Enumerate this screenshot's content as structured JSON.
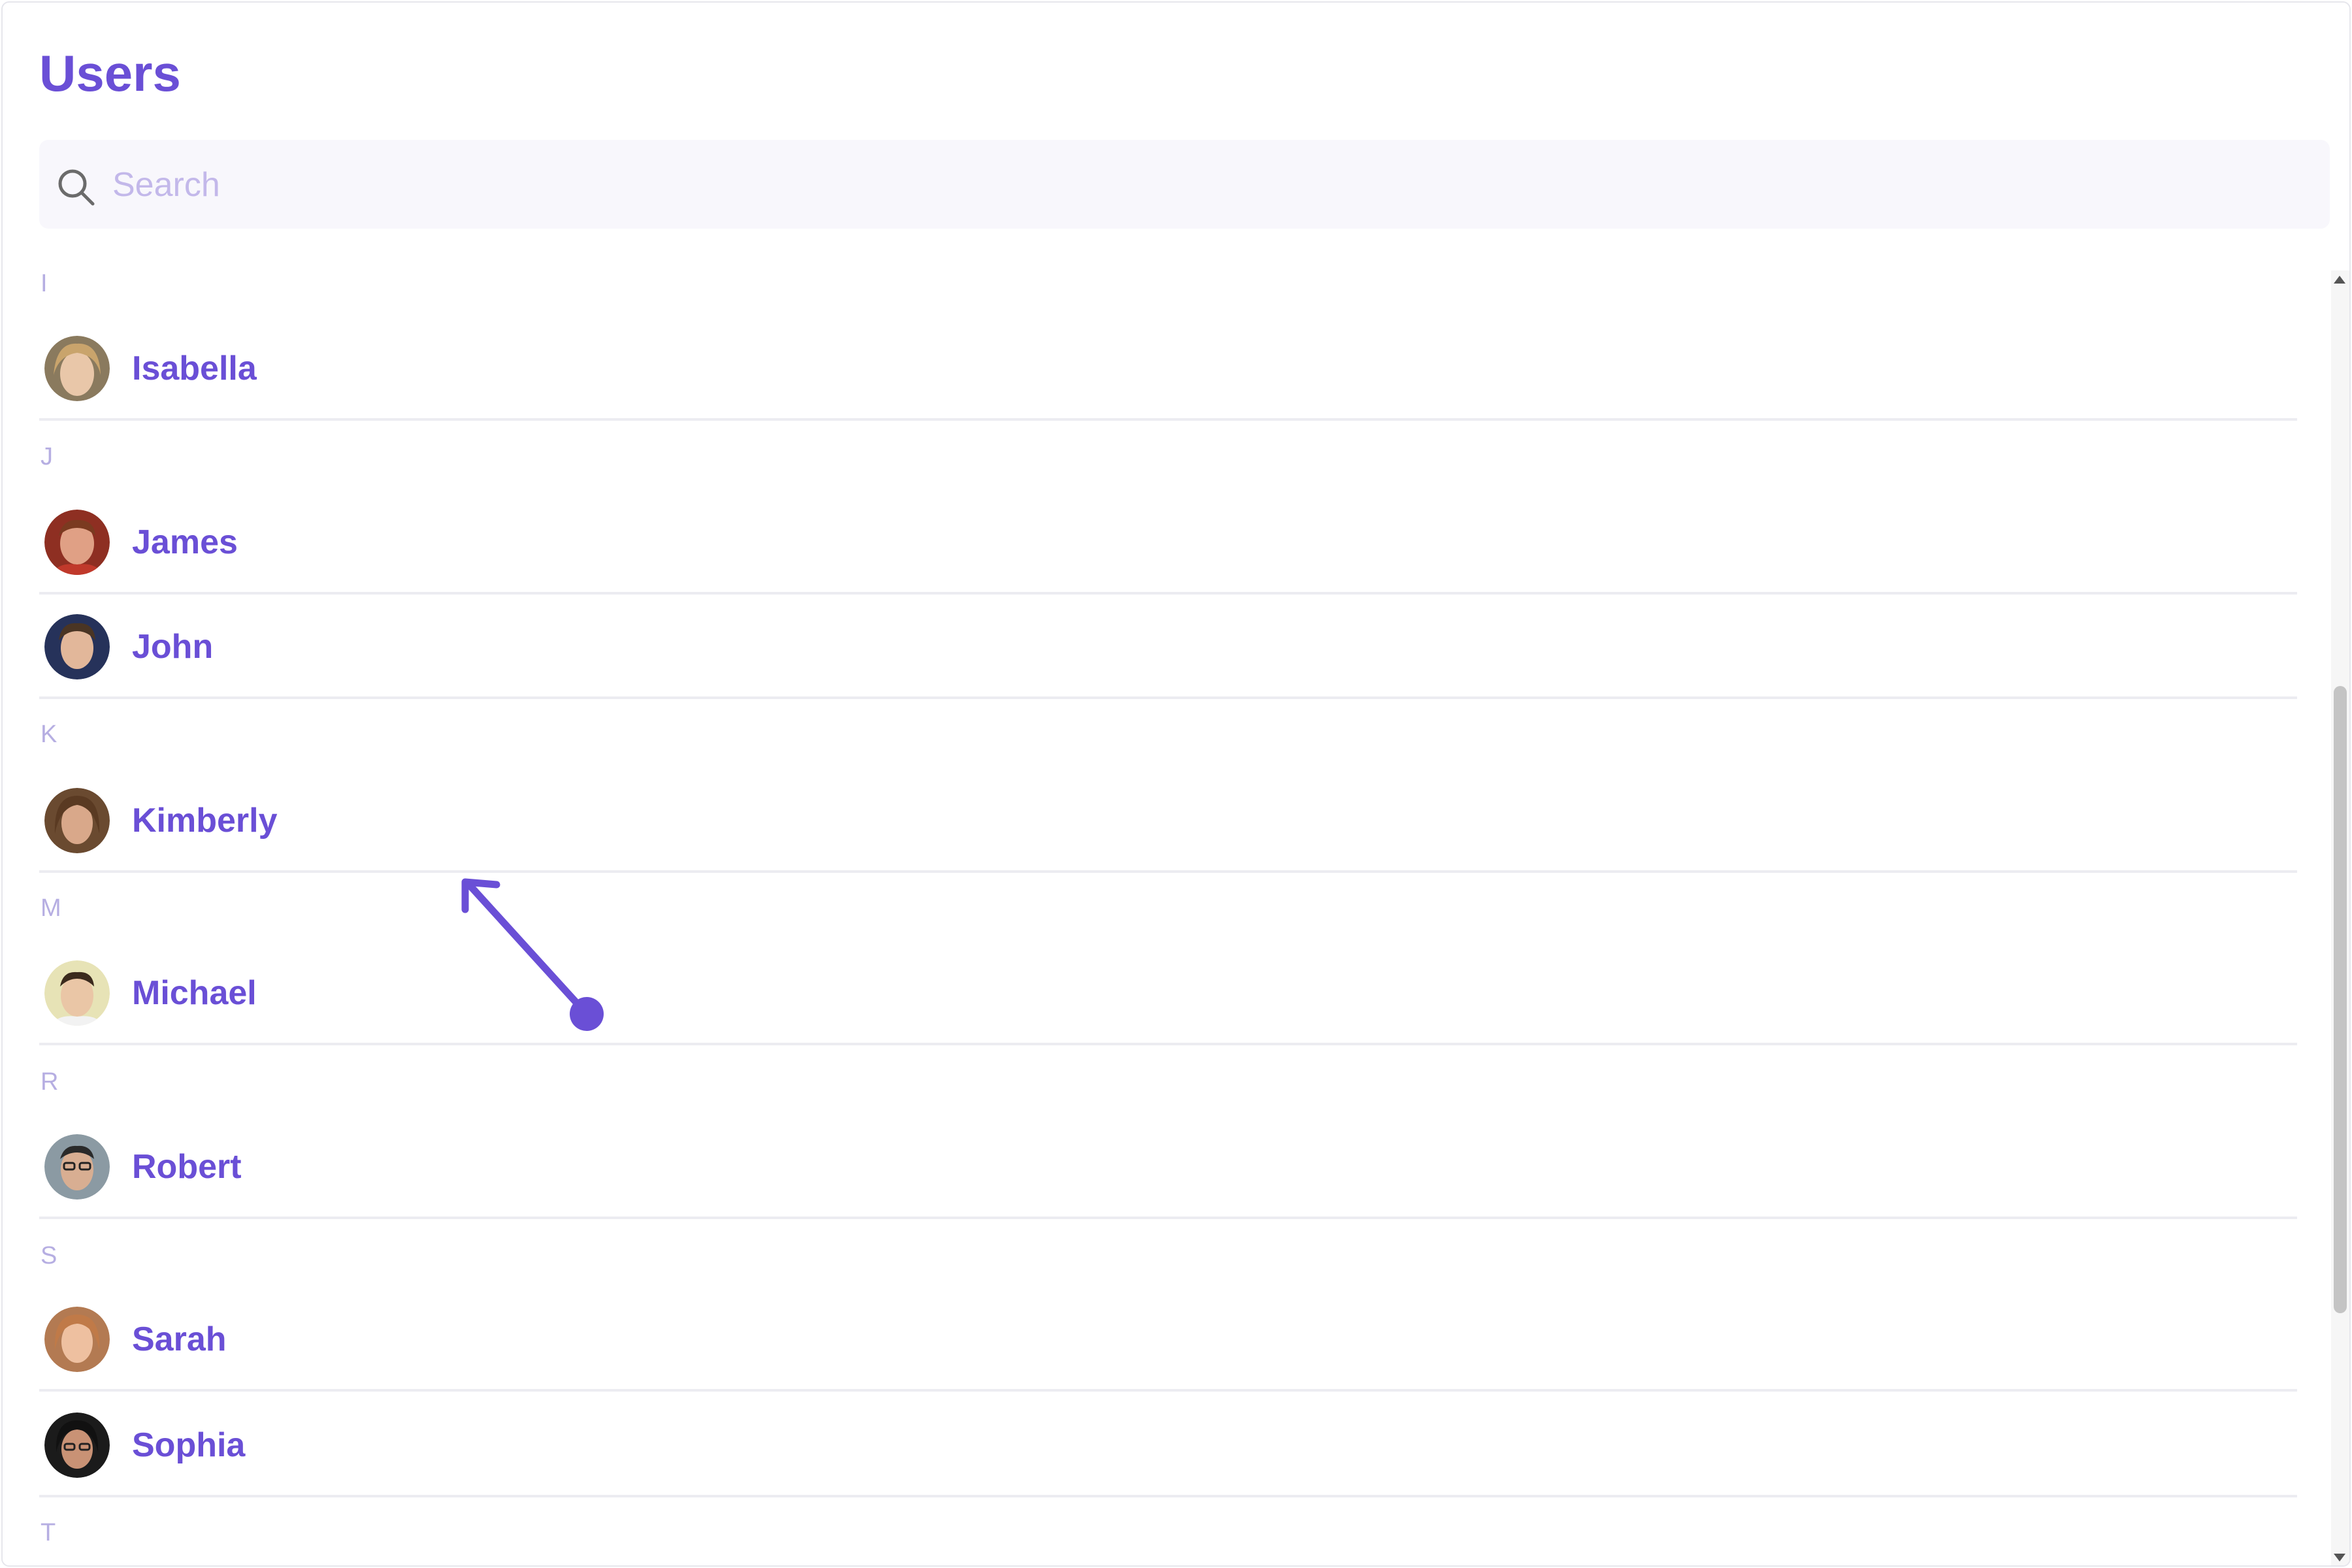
{
  "page": {
    "title": "Users"
  },
  "search": {
    "placeholder": "Search",
    "value": ""
  },
  "colors": {
    "accent": "#6a4fd6",
    "section_letter": "#b6aee2",
    "divider": "#ececf1",
    "search_bg": "#f8f7fc"
  },
  "icons": {
    "search": "search-icon",
    "drag_arrow": "arrow-up-left-icon",
    "drag_point": "touch-point-icon"
  },
  "list": {
    "sections": [
      {
        "letter": "I",
        "users": [
          {
            "name": "Isabella",
            "avatar": "avatar-isabella"
          }
        ]
      },
      {
        "letter": "J",
        "users": [
          {
            "name": "James",
            "avatar": "avatar-james"
          },
          {
            "name": "John",
            "avatar": "avatar-john"
          }
        ]
      },
      {
        "letter": "K",
        "users": [
          {
            "name": "Kimberly",
            "avatar": "avatar-kimberly"
          }
        ]
      },
      {
        "letter": "M",
        "users": [
          {
            "name": "Michael",
            "avatar": "avatar-michael"
          }
        ]
      },
      {
        "letter": "R",
        "users": [
          {
            "name": "Robert",
            "avatar": "avatar-robert"
          }
        ]
      },
      {
        "letter": "S",
        "users": [
          {
            "name": "Sarah",
            "avatar": "avatar-sarah"
          },
          {
            "name": "Sophia",
            "avatar": "avatar-sophia"
          }
        ]
      },
      {
        "letter": "T",
        "users": []
      }
    ]
  }
}
